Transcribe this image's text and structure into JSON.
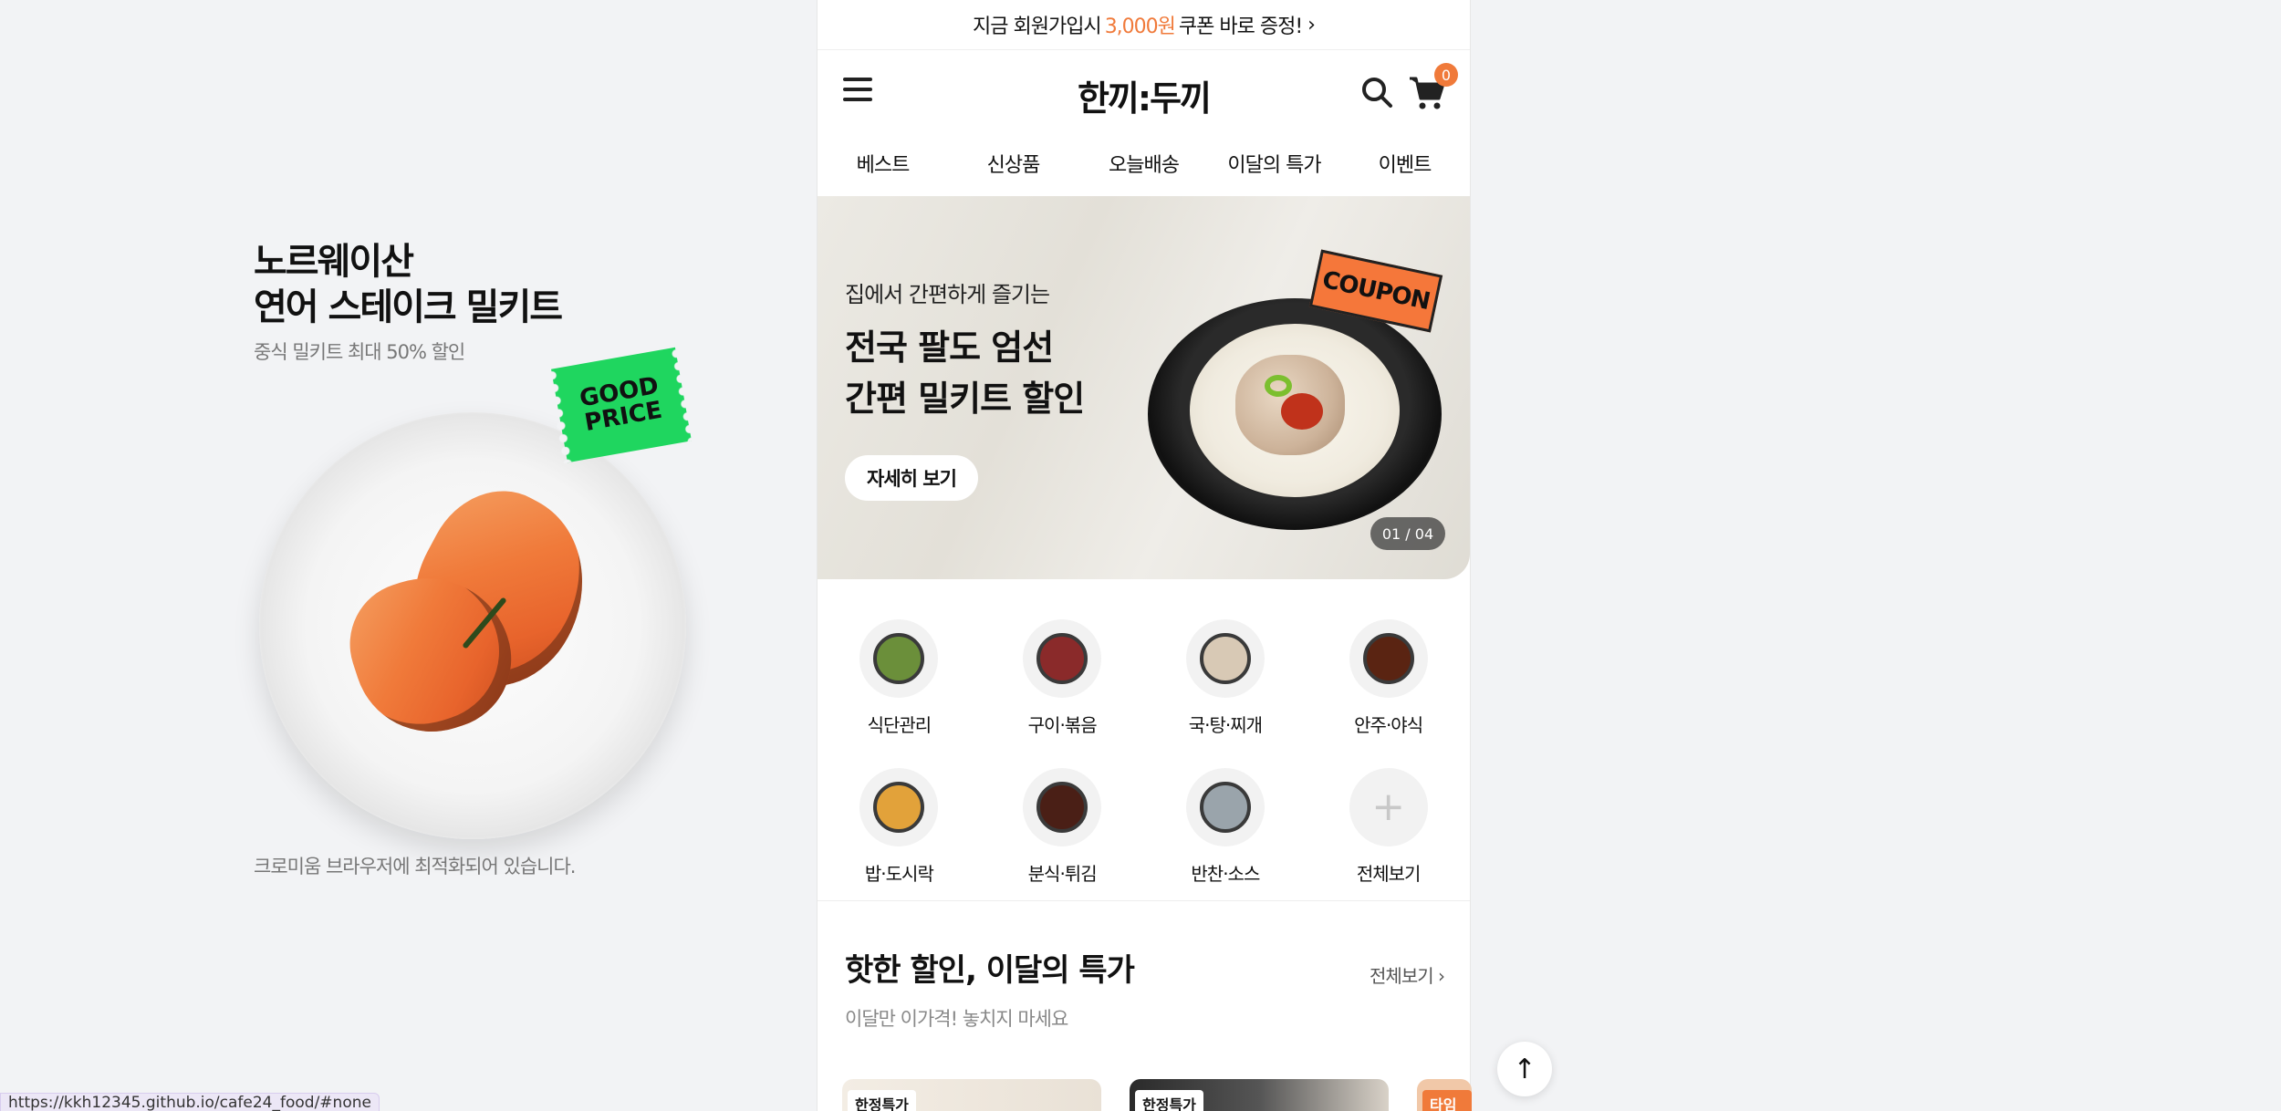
{
  "promo": {
    "title_line1": "노르웨이산",
    "title_line2": "연어 스테이크 밀키트",
    "subtitle": "중식 밀키트 최대 50% 할인",
    "sticker": "GOOD PRICE",
    "note": "크로미움 브라우저에 최적화되어 있습니다."
  },
  "topbar": {
    "prefix": "지금 회원가입시",
    "amount": "3,000원",
    "suffix": "쿠폰 바로 증정!",
    "accent_color": "#f07a3a"
  },
  "header": {
    "logo": "한끼:두끼",
    "cart_count": "0"
  },
  "nav": {
    "items": [
      "베스트",
      "신상품",
      "오늘배송",
      "이달의 특가",
      "이벤트"
    ]
  },
  "hero": {
    "subtitle": "집에서 간편하게 즐기는",
    "title_line1": "전국 팔도 엄선",
    "title_line2": "간편 밀키트 할인",
    "button": "자세히 보기",
    "coupon": "COUPON",
    "pager": "01 / 04"
  },
  "categories": [
    {
      "label": "식단관리",
      "icon": "salad-icon",
      "color": "#6b8f3a"
    },
    {
      "label": "구이·볶음",
      "icon": "meat-icon",
      "color": "#8a2a2a"
    },
    {
      "label": "국·탕·찌개",
      "icon": "soup-icon",
      "color": "#d8c9b5"
    },
    {
      "label": "안주·야식",
      "icon": "ribs-icon",
      "color": "#5a2412"
    },
    {
      "label": "밥·도시락",
      "icon": "rice-icon",
      "color": "#e2a23a"
    },
    {
      "label": "분식·튀김",
      "icon": "fried-icon",
      "color": "#4a1f16"
    },
    {
      "label": "반찬·소스",
      "icon": "sidedish-icon",
      "color": "#9aa4ab"
    },
    {
      "label": "전체보기",
      "icon": "plus-icon",
      "color": "#c8c8c8"
    }
  ],
  "section": {
    "title": "핫한 할인, 이달의 특가",
    "subtitle": "이달만 이가격! 놓치지 마세요",
    "see_all": "전체보기"
  },
  "cards": [
    {
      "tag": "한정특가"
    },
    {
      "tag": "한정특가"
    },
    {
      "tag": "타임딜"
    }
  ],
  "status_url": "https://kkh12345.github.io/cafe24_food/#none",
  "scroll_top": "↑"
}
